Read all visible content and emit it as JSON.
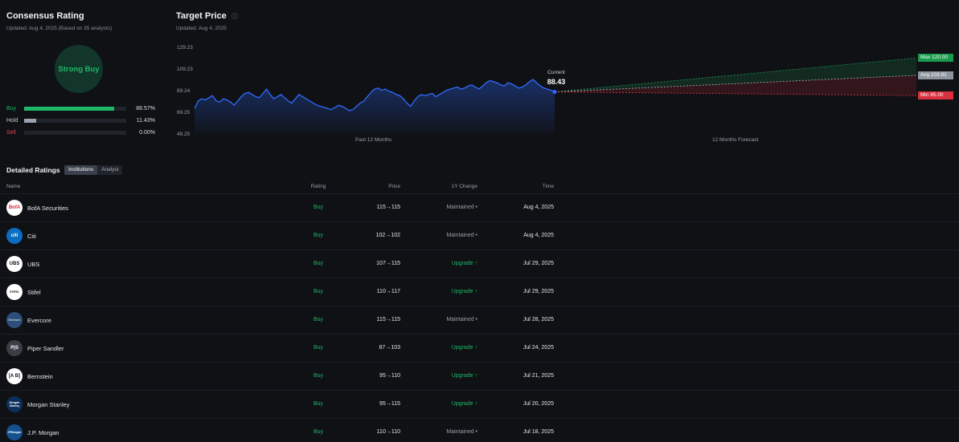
{
  "consensus": {
    "title": "Consensus Rating",
    "updated": "Updated: Aug 4, 2025 (Based on 35 analysts)",
    "rating": "Strong Buy",
    "rows": [
      {
        "label": "Buy",
        "pct": "88.57%",
        "fraction": 0.8857,
        "color": "#1fb866",
        "label_color": "#1fb866"
      },
      {
        "label": "Hold",
        "pct": "11.43%",
        "fraction": 0.1143,
        "color": "#9aa3b0",
        "label_color": "#c6cad0"
      },
      {
        "label": "Sell",
        "pct": "0.00%",
        "fraction": 0.0,
        "color": "#e0434f",
        "label_color": "#e0434f"
      }
    ]
  },
  "target": {
    "title": "Target Price",
    "info_icon": "info-circle-icon",
    "updated": "Updated: Aug 4, 2025",
    "yticks": [
      "129.23",
      "109.23",
      "89.24",
      "69.25",
      "49.25"
    ],
    "current_label": "Current",
    "current_value": "88.43",
    "max_label": "Max  120.00",
    "avg_label": "Avg  103.91",
    "min_label": "Min  85.00",
    "past_caption": "Past 12 Months",
    "forecast_caption": "12 Months Forecast"
  },
  "chart_data": {
    "type": "line",
    "title": "Target Price",
    "ylim": [
      49.25,
      129.23
    ],
    "history": [
      73,
      80,
      82,
      81,
      83,
      85,
      80,
      79,
      82,
      81,
      79,
      76,
      80,
      84,
      87,
      88,
      86,
      84,
      83,
      87,
      91,
      86,
      82,
      84,
      86,
      83,
      80,
      78,
      82,
      86,
      84,
      82,
      80,
      78,
      76,
      75,
      74,
      73,
      72,
      74,
      76,
      75,
      73,
      71,
      72,
      75,
      78,
      80,
      84,
      88,
      91,
      92,
      90,
      91,
      89,
      88,
      86,
      85,
      82,
      78,
      75,
      80,
      84,
      86,
      85,
      86,
      87,
      84,
      86,
      88,
      90,
      91,
      92,
      93,
      91,
      92,
      94,
      95,
      93,
      91,
      94,
      97,
      99,
      98,
      97,
      95,
      94,
      97,
      96,
      94,
      92,
      93,
      95,
      98,
      100,
      97,
      94,
      92,
      91,
      90,
      88.43
    ],
    "current": 88.43,
    "forecast": {
      "max": 120.0,
      "avg": 103.91,
      "min": 85.0
    },
    "colors": {
      "line": "#2f6bff",
      "max": "#1f9f55",
      "avg": "#b0b6c0",
      "min": "#d9303f"
    }
  },
  "detailed": {
    "title": "Detailed Ratings",
    "tabs": [
      "Institutions",
      "Analyst"
    ],
    "headers": {
      "name": "Name",
      "rating": "Rating",
      "price": "Price",
      "change": "1Y Change",
      "time": "Time"
    },
    "rows": [
      {
        "name": "BofA Securities",
        "logo": "BofA",
        "logo_bg": "#ffffff",
        "logo_fg": "#d22630",
        "rating": "Buy",
        "price": "115→115",
        "change": "Maintained •",
        "change_type": "maintained",
        "time": "Aug 4, 2025"
      },
      {
        "name": "Citi",
        "logo": "citi",
        "logo_bg": "#0a6dc2",
        "logo_fg": "#ffffff",
        "rating": "Buy",
        "price": "102→102",
        "change": "Maintained •",
        "change_type": "maintained",
        "time": "Aug 4, 2025"
      },
      {
        "name": "UBS",
        "logo": "UBS",
        "logo_bg": "#ffffff",
        "logo_fg": "#111111",
        "rating": "Buy",
        "price": "107→115",
        "change": "Upgrade ↑",
        "change_type": "upgrade",
        "time": "Jul 29, 2025"
      },
      {
        "name": "Stifel",
        "logo": "STIFEL",
        "logo_bg": "#ffffff",
        "logo_fg": "#111111",
        "rating": "Buy",
        "price": "110→117",
        "change": "Upgrade ↑",
        "change_type": "upgrade",
        "time": "Jul 29, 2025"
      },
      {
        "name": "Evercore",
        "logo": "Evercore",
        "logo_bg": "#2e4f7a",
        "logo_fg": "#cfd8e6",
        "rating": "Buy",
        "price": "115→115",
        "change": "Maintained •",
        "change_type": "maintained",
        "time": "Jul 28, 2025"
      },
      {
        "name": "Piper Sandler",
        "logo": "P|S",
        "logo_bg": "#3a3f47",
        "logo_fg": "#ffffff",
        "rating": "Buy",
        "price": "87→103",
        "change": "Upgrade ↑",
        "change_type": "upgrade",
        "time": "Jul 24, 2025"
      },
      {
        "name": "Bernstein",
        "logo": "[A B]",
        "logo_bg": "#ffffff",
        "logo_fg": "#111111",
        "rating": "Buy",
        "price": "95→110",
        "change": "Upgrade ↑",
        "change_type": "upgrade",
        "time": "Jul 21, 2025"
      },
      {
        "name": "Morgan Stanley",
        "logo": "Morgan Stanley",
        "logo_bg": "#0d2f5c",
        "logo_fg": "#ffffff",
        "rating": "Buy",
        "price": "95→115",
        "change": "Upgrade ↑",
        "change_type": "upgrade",
        "time": "Jul 20, 2025"
      },
      {
        "name": "J.P. Morgan",
        "logo": "JPMorgan",
        "logo_bg": "#15508f",
        "logo_fg": "#ffffff",
        "rating": "Buy",
        "price": "110→110",
        "change": "Maintained •",
        "change_type": "maintained",
        "time": "Jul 18, 2025"
      }
    ]
  }
}
